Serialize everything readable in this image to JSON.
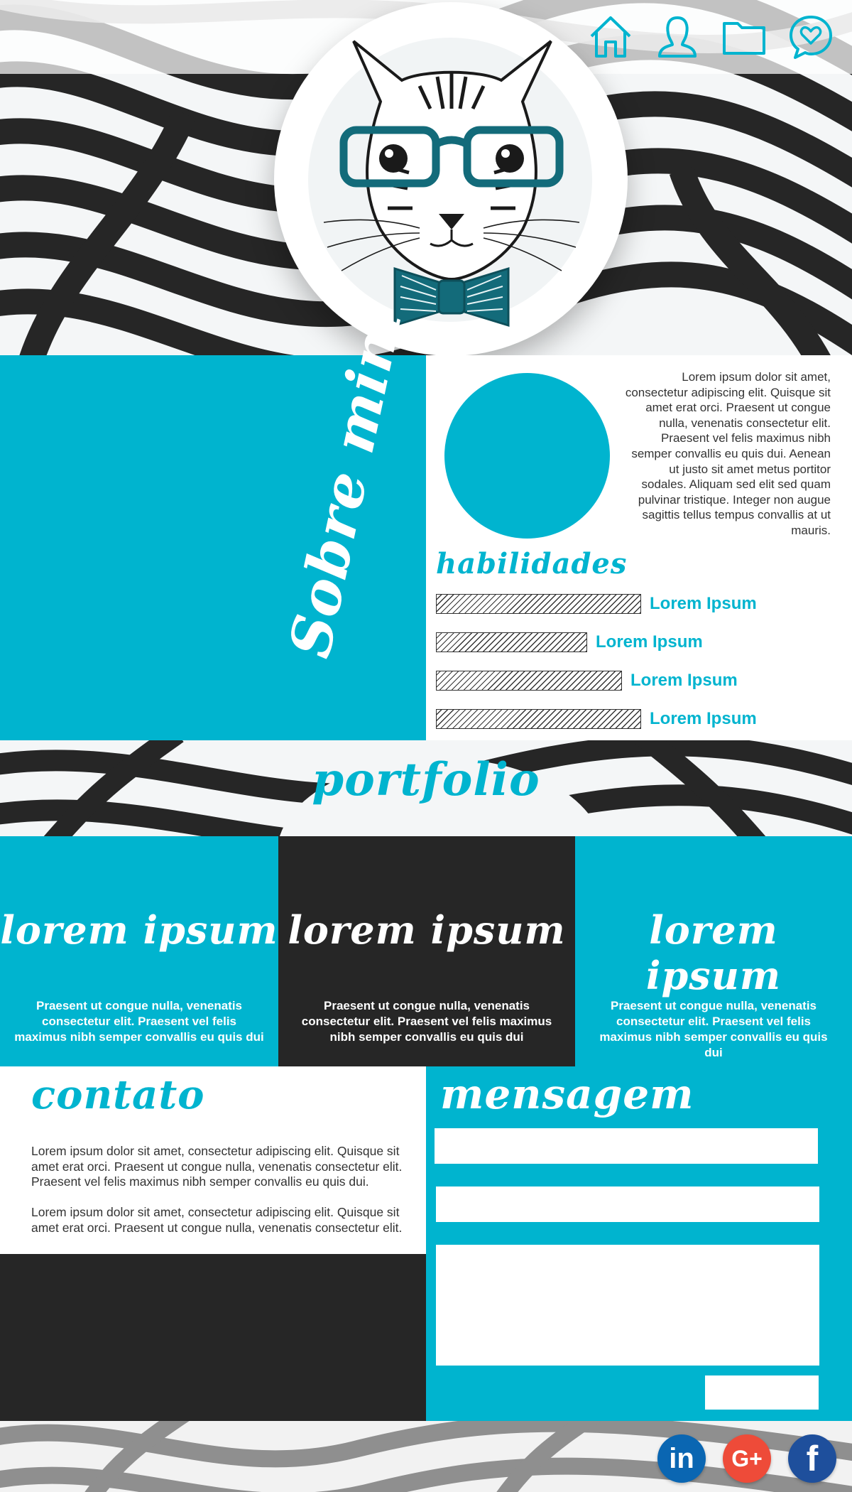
{
  "nav": {
    "items": [
      {
        "icon": "home-icon"
      },
      {
        "icon": "user-icon"
      },
      {
        "icon": "folder-icon"
      },
      {
        "icon": "chat-heart-icon"
      }
    ]
  },
  "hero": {
    "avatar_icon": "cat-with-glasses-icon"
  },
  "about": {
    "title": "Sobre mim",
    "text": "Lorem ipsum dolor sit amet, consectetur adipiscing elit. Quisque sit amet erat orci. Praesent ut congue nulla, venenatis consectetur elit. Praesent vel felis maximus nibh semper convallis eu quis dui. Aenean ut justo sit amet metus portitor sodales. Aliquam sed elit sed quam pulvinar tristique. Integer non augue sagittis tellus tempus convallis at ut mauris."
  },
  "skills": {
    "title": "habilidades",
    "items": [
      {
        "label": "Lorem Ipsum",
        "level": 0.76
      },
      {
        "label": "Lorem Ipsum",
        "level": 0.56
      },
      {
        "label": "Lorem Ipsum",
        "level": 0.69
      },
      {
        "label": "Lorem Ipsum",
        "level": 0.76
      }
    ]
  },
  "portfolio": {
    "title": "portfolio",
    "cards": [
      {
        "title": "lorem ipsum",
        "text": "Praesent ut congue nulla, venenatis consectetur elit. Praesent vel felis maximus nibh semper convallis eu quis dui"
      },
      {
        "title": "lorem ipsum",
        "text": "Praesent ut congue nulla, venenatis consectetur elit. Praesent vel felis maximus nibh semper convallis eu quis dui"
      },
      {
        "title": "lorem ipsum",
        "text": "Praesent ut congue nulla, venenatis consectetur elit. Praesent vel felis maximus nibh semper convallis eu quis dui"
      }
    ]
  },
  "contact": {
    "title": "contato",
    "paragraph_1": "Lorem ipsum dolor sit amet, consectetur adipiscing elit. Quisque sit amet erat orci. Praesent ut congue nulla, venenatis consectetur elit. Praesent vel felis maximus nibh semper convallis eu quis dui.",
    "paragraph_2": "Lorem ipsum dolor sit amet, consectetur adipiscing elit. Quisque sit amet erat orci. Praesent ut congue nulla, venenatis consectetur elit."
  },
  "message": {
    "title": "mensagem",
    "name_value": "",
    "email_value": "",
    "body_value": "",
    "send_label": ""
  },
  "social": {
    "items": [
      {
        "icon": "linkedin-icon",
        "label": "in",
        "color": "#0a66b2"
      },
      {
        "icon": "google-plus-icon",
        "label": "G+",
        "color": "#ee4b39"
      },
      {
        "icon": "facebook-icon",
        "label": "f",
        "color": "#1e4f9c"
      }
    ]
  },
  "colors": {
    "accent": "#00b4cf",
    "dark": "#262626",
    "icon_teal": "#136b7a"
  }
}
